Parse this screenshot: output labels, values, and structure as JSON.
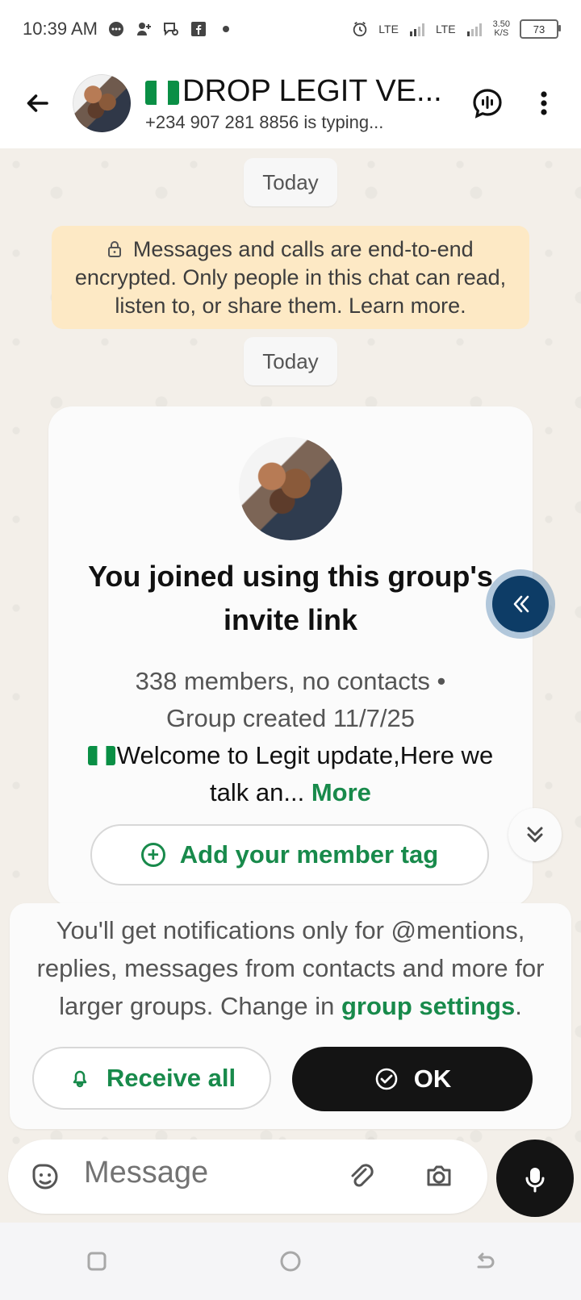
{
  "status_bar": {
    "time": "10:39 AM",
    "lte_1": "LTE",
    "lte_2": "LTE",
    "network_speed": "3.50",
    "network_speed_unit": "K/S",
    "battery": "73"
  },
  "header": {
    "title": "DROP LEGIT VE...",
    "subtitle": "+234 907 281 8856 is typing..."
  },
  "chat": {
    "day_label_1": "Today",
    "encryption_text": "Messages and calls are end-to-end encrypted. Only people in this chat can read, listen to, or share them. Learn more.",
    "day_label_2": "Today",
    "group_card": {
      "joined_text": "You joined using this group's invite link",
      "meta_line_1": "338 members, no contacts •",
      "meta_line_2": "Group created 11/7/25",
      "description": "Welcome to Legit update,Here we talk an...",
      "more": "More",
      "member_tag_button": "Add your member tag"
    },
    "notification_card": {
      "text_prefix": "You'll get notifications only for @mentions, replies, messages from contacts and more for larger groups. Change in ",
      "link_text": "group settings",
      "text_suffix": ".",
      "receive_all_button": "Receive all",
      "ok_button": "OK"
    }
  },
  "composer": {
    "placeholder": "Message"
  },
  "icons": {
    "back": "back-arrow-icon",
    "voice_chat": "voice-chat-icon",
    "more": "more-vertical-icon",
    "lock": "lock-icon",
    "double_left": "double-chevron-left-icon",
    "double_down": "double-chevron-down-icon",
    "bell": "bell-icon",
    "check_circle": "check-circle-icon",
    "sticker": "sticker-icon",
    "attach": "attach-icon",
    "camera": "camera-icon",
    "mic": "mic-icon",
    "nav_square": "recent-apps-icon",
    "nav_circle": "home-icon",
    "nav_back": "back-nav-icon"
  },
  "colors": {
    "brand_green": "#188a4b",
    "encryption_bg": "#fde9c5",
    "accent_blue": "#0d3c66"
  }
}
